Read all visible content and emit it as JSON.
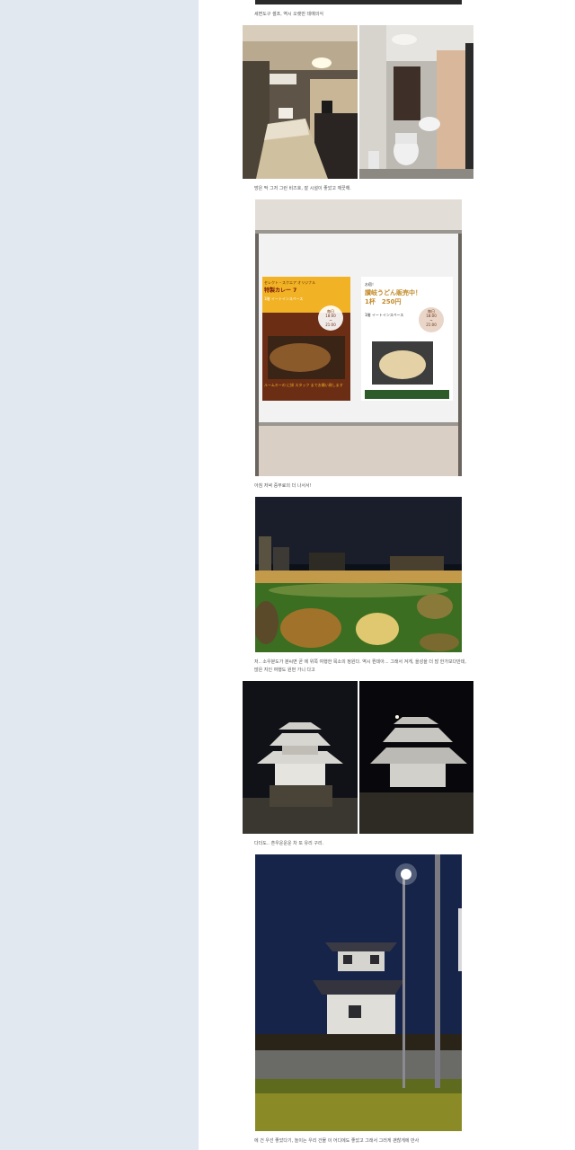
{
  "captions": {
    "c1": "세면도구 셀프, 역시 오랫만 데예의식",
    "c2": "방은 딱 그저 그런 비즈호, 잘 시설이 좋았고 깨끗해.",
    "c3": "아침 저녁 중무료의 더 나서서!",
    "c4a": "저.. 소우분도가 분씨면 곧 에 위쪽 여행한 목소의 정원다. 역시 뭔데아... 그래서 겨게, 을성을 더 많 한가보다만데,",
    "c4b": "많은 지인 여행도 원번 가니 다고",
    "c5": "다더도.. 흔우운운운 차 또 유리 구리.",
    "c6": "에 건 우선 좋았다기, 놀이는 우리 건물 이 어디에도 좋았고 그래서 그러게 괜찮게에 만사"
  },
  "poster": {
    "left_header": "セレクト・スクエア オリジナル",
    "left_title": "特製カレー 7",
    "left_sub": "1階 イートインスペース",
    "left_badge_1": "毎日",
    "left_badge_2": "18:00",
    "left_badge_3": "~",
    "left_badge_4": "21:00",
    "left_footer": "ルームキーの に掛 スタッフ までお願い致します",
    "right_header": "お宿！",
    "right_title_1": "讃岐うどん販売中！",
    "right_title_2": "1杯　250円",
    "right_sub": "1階 イートインスペース",
    "right_badge_1": "毎日",
    "right_badge_2": "18:00",
    "right_badge_3": "~",
    "right_badge_4": "21:00"
  },
  "colors": {
    "sidebar": "#e1e8ef",
    "page": "#ffffff",
    "caption": "#555555"
  }
}
